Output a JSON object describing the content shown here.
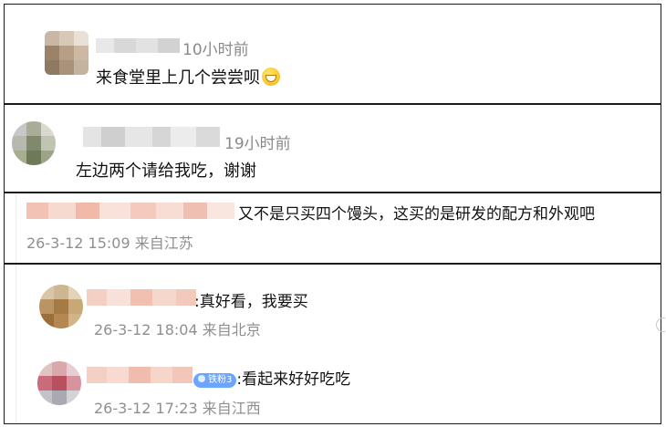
{
  "comments": [
    {
      "time": "10小时前",
      "text": "来食堂里上几个尝尝呗",
      "emoji_icon": "grinning-face-emoji"
    },
    {
      "time": "19小时前",
      "text": "左边两个请给我吃，谢谢"
    },
    {
      "text": "又不是只买四个馒头，这买的是研发的配方和外观吧",
      "date": "26-3-12 15:09",
      "location": "来自江苏"
    }
  ],
  "replies": [
    {
      "text": ":真好看，我要买",
      "date": "26-3-12 18:04",
      "location": "来自北京"
    },
    {
      "badge": "铁粉3",
      "text": ":看起来好好吃吃",
      "date": "26-3-12 17:23",
      "location": "来自江西"
    }
  ],
  "colors": {
    "border": "#1a1a1a",
    "meta_text": "#8f8f8f",
    "badge": "#6aa5ff"
  }
}
